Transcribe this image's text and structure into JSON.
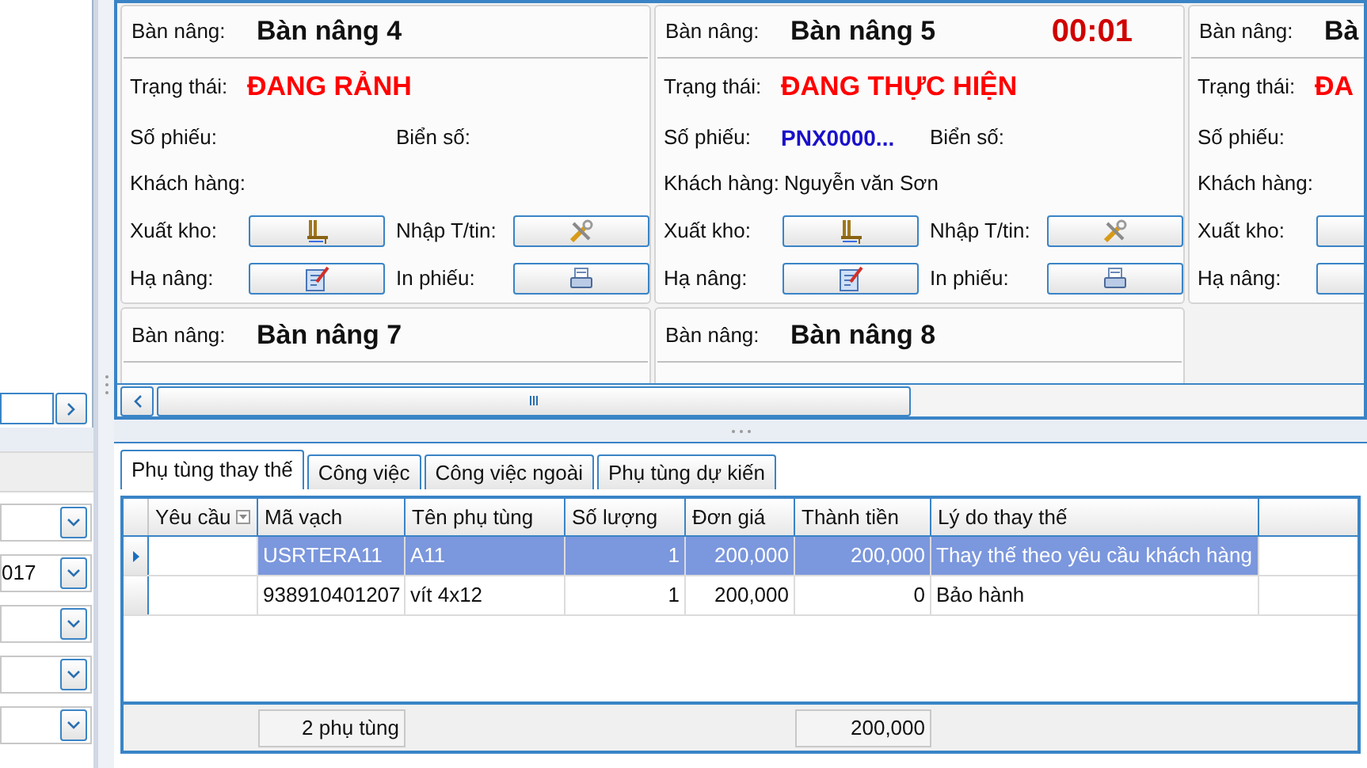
{
  "left_panel": {
    "combos": [
      {
        "kind": "blank"
      },
      {
        "kind": "filled",
        "value": "017"
      },
      {
        "kind": "blank"
      },
      {
        "kind": "blank"
      },
      {
        "kind": "blank"
      }
    ]
  },
  "lifts": {
    "rows": [
      [
        {
          "kind": "full",
          "label": "Bàn nâng:",
          "name": "Bàn nâng 4",
          "status_label": "Trạng thái:",
          "status": "ĐANG RẢNH",
          "ticket_label": "Số phiếu:",
          "plate_label": "Biển số:",
          "customer_label": "Khách hàng:",
          "action_rows": [
            [
              {
                "label": "Xuất kho:"
              },
              {
                "label": "Nhập T/tin:"
              }
            ],
            [
              {
                "label": "Hạ nâng:"
              },
              {
                "label": "In phiếu:"
              }
            ]
          ]
        },
        {
          "kind": "full",
          "label": "Bàn nâng:",
          "name": "Bàn nâng 5",
          "timer": "00:01",
          "status_label": "Trạng thái:",
          "status": "ĐANG THỰC HIỆN",
          "ticket_label": "Số phiếu:",
          "ticket": "PNX0000...",
          "plate_label": "Biển số:",
          "customer_label": "Khách hàng:",
          "customer": "Nguyễn văn Sơn",
          "action_rows": [
            [
              {
                "label": "Xuất kho:"
              },
              {
                "label": "Nhập T/tin:"
              }
            ],
            [
              {
                "label": "Hạ nâng:"
              },
              {
                "label": "In phiếu:"
              }
            ]
          ]
        },
        {
          "kind": "full",
          "label": "Bàn nâng:",
          "name": "Bà",
          "status_label": "Trạng thái:",
          "status": "ĐA",
          "ticket_label": "Số phiếu:",
          "customer_label": "Khách hàng:",
          "action_rows": [
            [
              {
                "label": "Xuất kho:"
              }
            ],
            [
              {
                "label": "Hạ nâng:"
              }
            ]
          ]
        }
      ],
      [
        {
          "kind": "header",
          "label": "Bàn nâng:",
          "name": "Bàn nâng 7"
        },
        {
          "kind": "header",
          "label": "Bàn nâng:",
          "name": "Bàn nâng 8"
        }
      ]
    ]
  },
  "tabs": [
    {
      "label": "Phụ tùng thay thế",
      "selected": true
    },
    {
      "label": "Công việc",
      "selected": false
    },
    {
      "label": "Công việc ngoài",
      "selected": false
    },
    {
      "label": "Phụ tùng dự kiến",
      "selected": false
    }
  ],
  "table": {
    "columns": [
      {
        "label": "Yêu cầu",
        "filter": true
      },
      {
        "label": "Mã vạch",
        "filter": false
      },
      {
        "label": "Tên phụ tùng",
        "filter": false
      },
      {
        "label": "Số lượng",
        "filter": false
      },
      {
        "label": "Đơn giá",
        "filter": false
      },
      {
        "label": "Thành tiền",
        "filter": false
      },
      {
        "label": "Lý do thay thế",
        "filter": false
      }
    ],
    "rows": [
      {
        "selected": true,
        "cells": [
          null,
          "USRTERA11",
          "A11",
          "1",
          "200,000",
          "200,000",
          "Thay thế theo yêu cầu khách hàng"
        ]
      },
      {
        "selected": false,
        "cells": [
          null,
          "938910401207",
          "vít 4x12",
          "1",
          "200,000",
          "0",
          "Bảo hành"
        ]
      }
    ],
    "footer": {
      "count": "2 phụ tùng",
      "total": "200,000"
    }
  }
}
